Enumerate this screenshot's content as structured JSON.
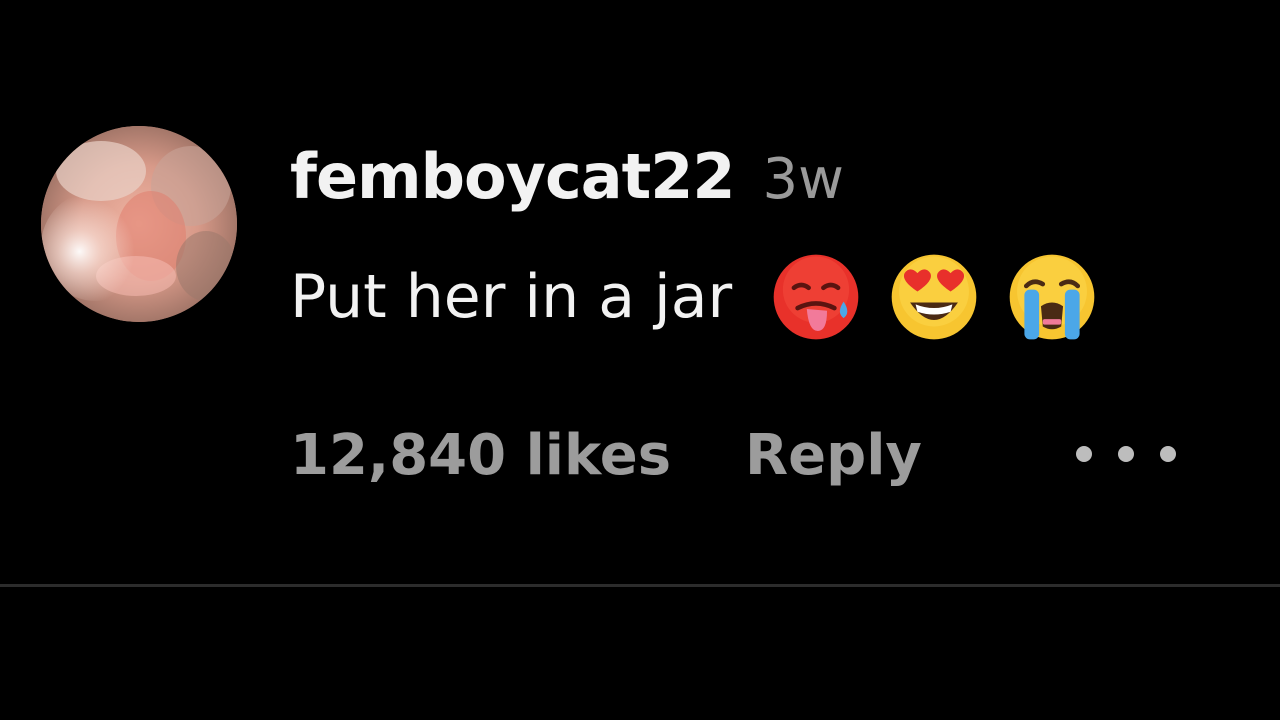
{
  "comment": {
    "avatar_icon": "cat-avatar",
    "username": "femboycat22",
    "timestamp": "3w",
    "text": "Put her in a jar",
    "emojis": [
      "hot-face-emoji",
      "star-struck-emoji",
      "loudly-crying-emoji"
    ],
    "likes_label": "12,840 likes",
    "reply_label": "Reply",
    "more_icon": "more-options-icon"
  },
  "colors": {
    "background": "#000000",
    "primary_text": "#f2f2f2",
    "secondary_text": "#9c9c9c",
    "divider": "#2c2c2c"
  }
}
